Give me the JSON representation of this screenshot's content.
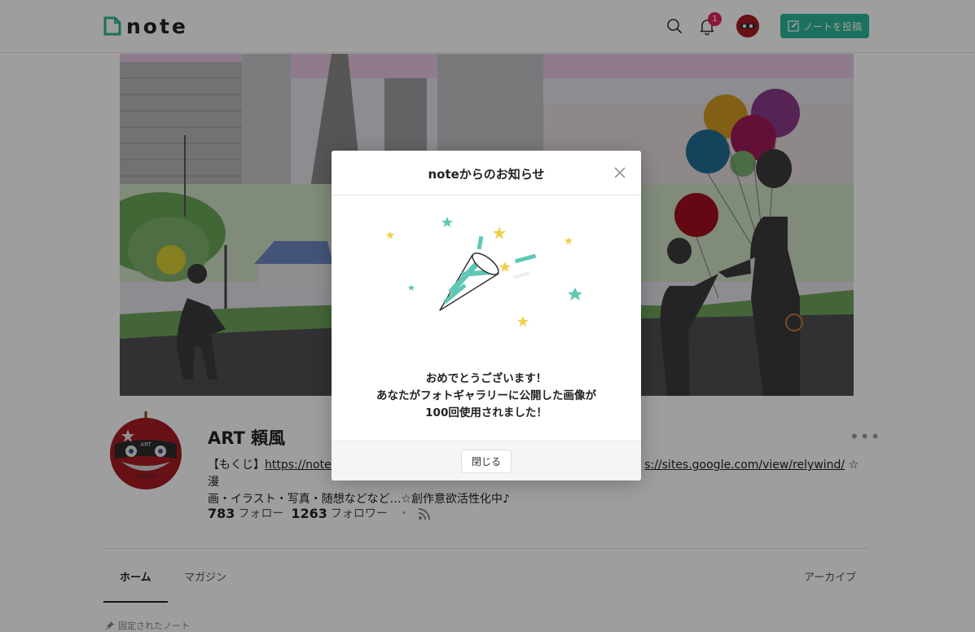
{
  "header": {
    "logo_text": "note",
    "notification_count": "1",
    "post_button_label": "ノートを投稿"
  },
  "profile": {
    "name": "ART 頼風",
    "bio_prefix": "【もくじ】",
    "bio_link1": "https://note.",
    "bio_link2": "s://sites.google.com/view/relywind/",
    "bio_suffix1": " ☆漫",
    "bio_line2": "画・イラスト・写真・随想などなど…☆創作意欲活性化中♪",
    "avatar_text_top": "ART",
    "avatar_text_bottom": "Relywind",
    "follow_count": "783",
    "follow_label": "フォロー",
    "follower_count": "1263",
    "follower_label": "フォロワー",
    "separator": "・",
    "more_label": "•••"
  },
  "tabs": {
    "home": "ホーム",
    "magazine": "マガジン",
    "archive": "アーカイブ"
  },
  "pinned_label": "固定されたノート",
  "modal": {
    "title": "noteからのお知らせ",
    "message_line1": "おめでとうございます！",
    "message_line2": "あなたがフォトギャラリーに公開した画像が",
    "message_line3": "100回使用されました！",
    "close_button": "閉じる"
  },
  "colors": {
    "brand_green": "#2cb696",
    "badge_red": "#e0245e",
    "overlay": "rgba(0,0,0,0.38)"
  },
  "icons": [
    "search-icon",
    "bell-icon",
    "pencil-icon",
    "rss-icon",
    "close-icon",
    "pin-icon"
  ]
}
